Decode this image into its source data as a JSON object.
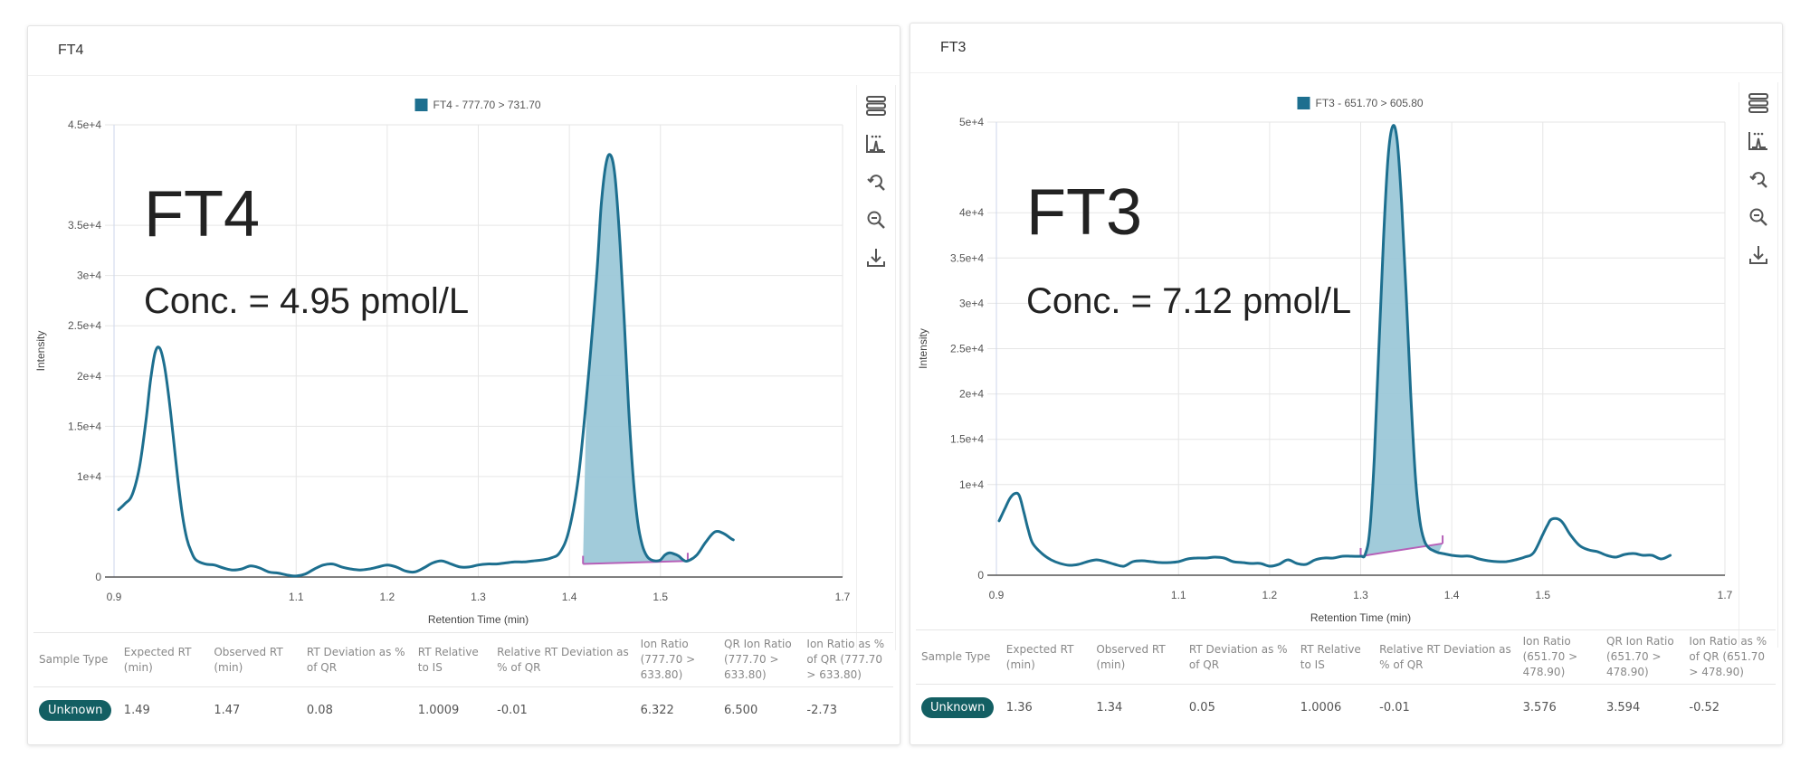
{
  "panels": [
    {
      "title": "FT4",
      "overlay": {
        "analyte": "FT4",
        "concentration": "Conc. = 4.95 pmol/L"
      },
      "toolbar": [
        {
          "icon": "menu-icon",
          "label": "Menu"
        },
        {
          "icon": "peak-integration-icon",
          "label": "Peak integration"
        },
        {
          "icon": "reset-zoom-icon",
          "label": "Reset zoom"
        },
        {
          "icon": "zoom-out-icon",
          "label": "Zoom out"
        },
        {
          "icon": "download-icon",
          "label": "Download"
        }
      ],
      "table": {
        "headers": [
          "Sample Type",
          "Expected RT (min)",
          "Observed RT (min)",
          "RT Deviation as % of QR",
          "RT Relative to IS",
          "Relative RT Deviation as % of QR",
          "Ion Ratio (777.70 > 633.80)",
          "QR Ion Ratio (777.70 > 633.80)",
          "Ion Ratio as % of QR (777.70 > 633.80)"
        ],
        "row": {
          "sample_type": "Unknown",
          "cells": [
            "1.49",
            "1.47",
            "0.08",
            "1.0009",
            "-0.01",
            "6.322",
            "6.500",
            "-2.73"
          ]
        }
      }
    },
    {
      "title": "FT3",
      "overlay": {
        "analyte": "FT3",
        "concentration": "Conc. = 7.12 pmol/L"
      },
      "toolbar": [
        {
          "icon": "menu-icon",
          "label": "Menu"
        },
        {
          "icon": "peak-integration-icon",
          "label": "Peak integration"
        },
        {
          "icon": "reset-zoom-icon",
          "label": "Reset zoom"
        },
        {
          "icon": "zoom-out-icon",
          "label": "Zoom out"
        },
        {
          "icon": "download-icon",
          "label": "Download"
        }
      ],
      "table": {
        "headers": [
          "Sample Type",
          "Expected RT (min)",
          "Observed RT (min)",
          "RT Deviation as % of QR",
          "RT Relative to IS",
          "Relative RT Deviation as % of QR",
          "Ion Ratio (651.70 > 478.90)",
          "QR Ion Ratio (651.70 > 478.90)",
          "Ion Ratio as % of QR (651.70 > 478.90)"
        ],
        "row": {
          "sample_type": "Unknown",
          "cells": [
            "1.36",
            "1.34",
            "0.05",
            "1.0006",
            "-0.01",
            "3.576",
            "3.594",
            "-0.52"
          ]
        }
      }
    }
  ],
  "colors": {
    "series": "#1d6f8f",
    "fill": "#9cc8d8",
    "baseline": "#b660b8",
    "badge": "#135f63"
  },
  "chart_data": [
    {
      "type": "area",
      "title": "FT4",
      "legend": {
        "label": "FT4 - 777.70 > 731.70",
        "position": "top-center"
      },
      "xlabel": "Retention Time (min)",
      "ylabel": "Intensity",
      "xlim": [
        0.9,
        1.7
      ],
      "ylim": [
        0,
        45000
      ],
      "xticks": [
        0.9,
        1.1,
        1.2,
        1.3,
        1.4,
        1.5,
        1.7
      ],
      "xtick_labels": [
        "0.9",
        "1.1",
        "1.2",
        "1.3",
        "1.4",
        "1.5",
        "1.7"
      ],
      "yticks": [
        0,
        10000,
        15000,
        20000,
        25000,
        30000,
        35000,
        45000
      ],
      "ytick_labels": [
        "0",
        "1e+4",
        "1.5e+4",
        "2e+4",
        "2.5e+4",
        "3e+4",
        "3.5e+4",
        "4.5e+4"
      ],
      "grid": true,
      "series": [
        {
          "name": "FT4 - 777.70 > 731.70",
          "x": [
            0.905,
            0.912,
            0.92,
            0.928,
            0.935,
            0.94,
            0.945,
            0.95,
            0.955,
            0.96,
            0.965,
            0.97,
            0.975,
            0.98,
            0.985,
            0.99,
            1.0,
            1.01,
            1.02,
            1.03,
            1.04,
            1.05,
            1.06,
            1.07,
            1.08,
            1.09,
            1.1,
            1.11,
            1.12,
            1.13,
            1.14,
            1.15,
            1.16,
            1.17,
            1.18,
            1.19,
            1.2,
            1.21,
            1.22,
            1.23,
            1.24,
            1.25,
            1.26,
            1.27,
            1.28,
            1.29,
            1.3,
            1.31,
            1.32,
            1.33,
            1.34,
            1.35,
            1.36,
            1.37,
            1.38,
            1.39,
            1.4,
            1.41,
            1.42,
            1.43,
            1.435,
            1.44,
            1.445,
            1.45,
            1.455,
            1.46,
            1.465,
            1.47,
            1.475,
            1.48,
            1.485,
            1.49,
            1.495,
            1.5,
            1.505,
            1.51,
            1.515,
            1.52,
            1.525,
            1.53,
            1.54,
            1.55,
            1.56,
            1.57,
            1.58,
            1.59,
            1.6,
            1.61,
            1.62,
            1.63
          ],
          "y": [
            6700,
            7300,
            8200,
            11000,
            15500,
            19500,
            22300,
            22800,
            21200,
            18000,
            14000,
            9800,
            6200,
            3800,
            2500,
            1700,
            1300,
            1200,
            900,
            700,
            800,
            1100,
            900,
            500,
            400,
            200,
            100,
            300,
            800,
            1200,
            1300,
            1000,
            800,
            700,
            800,
            1000,
            1200,
            1000,
            600,
            500,
            900,
            1400,
            1600,
            1300,
            1000,
            1000,
            1200,
            1300,
            1300,
            1400,
            1500,
            1500,
            1600,
            1700,
            1900,
            2500,
            4800,
            10000,
            19000,
            30000,
            37000,
            41000,
            42000,
            40000,
            34000,
            26000,
            17000,
            10000,
            5500,
            3200,
            2100,
            1700,
            1600,
            1700,
            2200,
            2400,
            2300,
            2100,
            1700,
            1600,
            2200,
            3500,
            4500,
            4300,
            3700,
            3600
          ]
        }
      ],
      "integration": {
        "start": 1.415,
        "end": 1.53,
        "baseline_start": 1300,
        "baseline_end": 1600,
        "apex_x": 1.465,
        "apex_y": 42000
      }
    },
    {
      "type": "area",
      "title": "FT3",
      "legend": {
        "label": "FT3 - 651.70 > 605.80",
        "position": "top-center"
      },
      "xlabel": "Retention Time (min)",
      "ylabel": "Intensity",
      "xlim": [
        0.9,
        1.7
      ],
      "ylim": [
        0,
        50000
      ],
      "xticks": [
        0.9,
        1.1,
        1.2,
        1.3,
        1.4,
        1.5,
        1.7
      ],
      "xtick_labels": [
        "0.9",
        "1.1",
        "1.2",
        "1.3",
        "1.4",
        "1.5",
        "1.7"
      ],
      "yticks": [
        0,
        10000,
        15000,
        20000,
        25000,
        30000,
        35000,
        40000,
        50000
      ],
      "ytick_labels": [
        "0",
        "1e+4",
        "1.5e+4",
        "2e+4",
        "2.5e+4",
        "3e+4",
        "3.5e+4",
        "4e+4",
        "5e+4"
      ],
      "grid": true,
      "series": [
        {
          "name": "FT3 - 651.70 > 605.80",
          "x": [
            0.903,
            0.91,
            0.915,
            0.92,
            0.925,
            0.93,
            0.935,
            0.94,
            0.95,
            0.96,
            0.97,
            0.98,
            0.99,
            1.0,
            1.01,
            1.02,
            1.03,
            1.04,
            1.05,
            1.06,
            1.07,
            1.08,
            1.09,
            1.1,
            1.11,
            1.12,
            1.13,
            1.14,
            1.15,
            1.16,
            1.17,
            1.18,
            1.19,
            1.2,
            1.21,
            1.22,
            1.23,
            1.24,
            1.25,
            1.26,
            1.27,
            1.28,
            1.29,
            1.3,
            1.305,
            1.31,
            1.315,
            1.32,
            1.325,
            1.33,
            1.335,
            1.34,
            1.345,
            1.35,
            1.355,
            1.36,
            1.365,
            1.37,
            1.375,
            1.38,
            1.385,
            1.39,
            1.4,
            1.41,
            1.42,
            1.43,
            1.44,
            1.45,
            1.46,
            1.47,
            1.48,
            1.49,
            1.5,
            1.505,
            1.51,
            1.52,
            1.53,
            1.54,
            1.55,
            1.56,
            1.57,
            1.58,
            1.59,
            1.6,
            1.61,
            1.62,
            1.63,
            1.64
          ],
          "y": [
            6000,
            7500,
            8500,
            9000,
            8800,
            7000,
            5000,
            3500,
            2400,
            1700,
            1300,
            1100,
            1200,
            1500,
            1700,
            1500,
            1200,
            1000,
            1500,
            1600,
            1500,
            1400,
            1400,
            1500,
            1800,
            1900,
            1900,
            2000,
            1900,
            1500,
            1400,
            1300,
            1300,
            1000,
            1200,
            1700,
            1300,
            1200,
            1700,
            1900,
            1900,
            2100,
            2100,
            2100,
            2300,
            5000,
            13000,
            25000,
            37000,
            46000,
            49500,
            48000,
            41000,
            31000,
            20000,
            11000,
            6000,
            3800,
            3000,
            2700,
            2500,
            2400,
            2200,
            2100,
            2100,
            1800,
            1600,
            1500,
            1500,
            1700,
            2000,
            2500,
            4500,
            5500,
            6200,
            6000,
            4500,
            3300,
            2800,
            2600,
            2200,
            2000,
            2300,
            2400,
            2200,
            2200,
            1800,
            2200
          ]
        }
      ],
      "integration": {
        "start": 1.3,
        "end": 1.39,
        "baseline_start": 2100,
        "baseline_end": 3500,
        "apex_x": 1.34,
        "apex_y": 49500
      }
    }
  ]
}
